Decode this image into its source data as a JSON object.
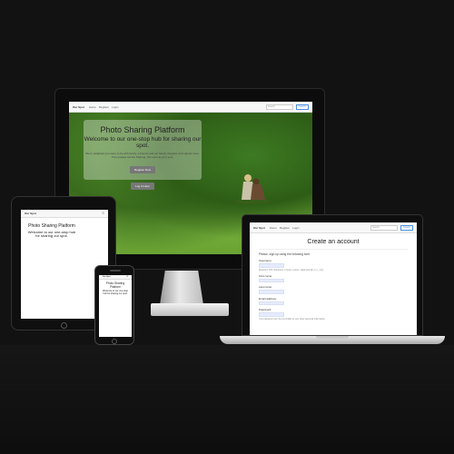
{
  "site": {
    "brand": "Our Spot",
    "nav": [
      "Home",
      "Register",
      "Login"
    ],
    "search_placeholder": "Search",
    "search_button": "Search"
  },
  "hero": {
    "title": "Photo Sharing Platform",
    "subtitle": "Welcome to our one-stop hub for sharing our spot.",
    "body": "We're delighted you were to be with family, a friends and our family, Register and upload more. Then please tell the Sharing, Not send at your spot.",
    "register_button": "Register Now",
    "login_button": "Log In Here"
  },
  "tablet": {
    "title": "Photo Sharing Platform",
    "subtitle": "Welcome to our one-stop hub for sharing our spot."
  },
  "phone": {
    "title": "Photo Sharing Platform",
    "subtitle": "Welcome to our one-stop hub for sharing our spot."
  },
  "register_form": {
    "title": "Create an account",
    "intro": "Please, sign up using the following form.",
    "fields": [
      {
        "label": "Username:",
        "help": "Required. 150 characters or fewer. Letters, digits and @/./+/-/_ only."
      },
      {
        "label": "First name:",
        "help": ""
      },
      {
        "label": "Last name:",
        "help": ""
      },
      {
        "label": "Email address:",
        "help": ""
      },
      {
        "label": "Password:",
        "help": ""
      }
    ],
    "footnote": "Your password can't be too similar to your other personal information."
  }
}
